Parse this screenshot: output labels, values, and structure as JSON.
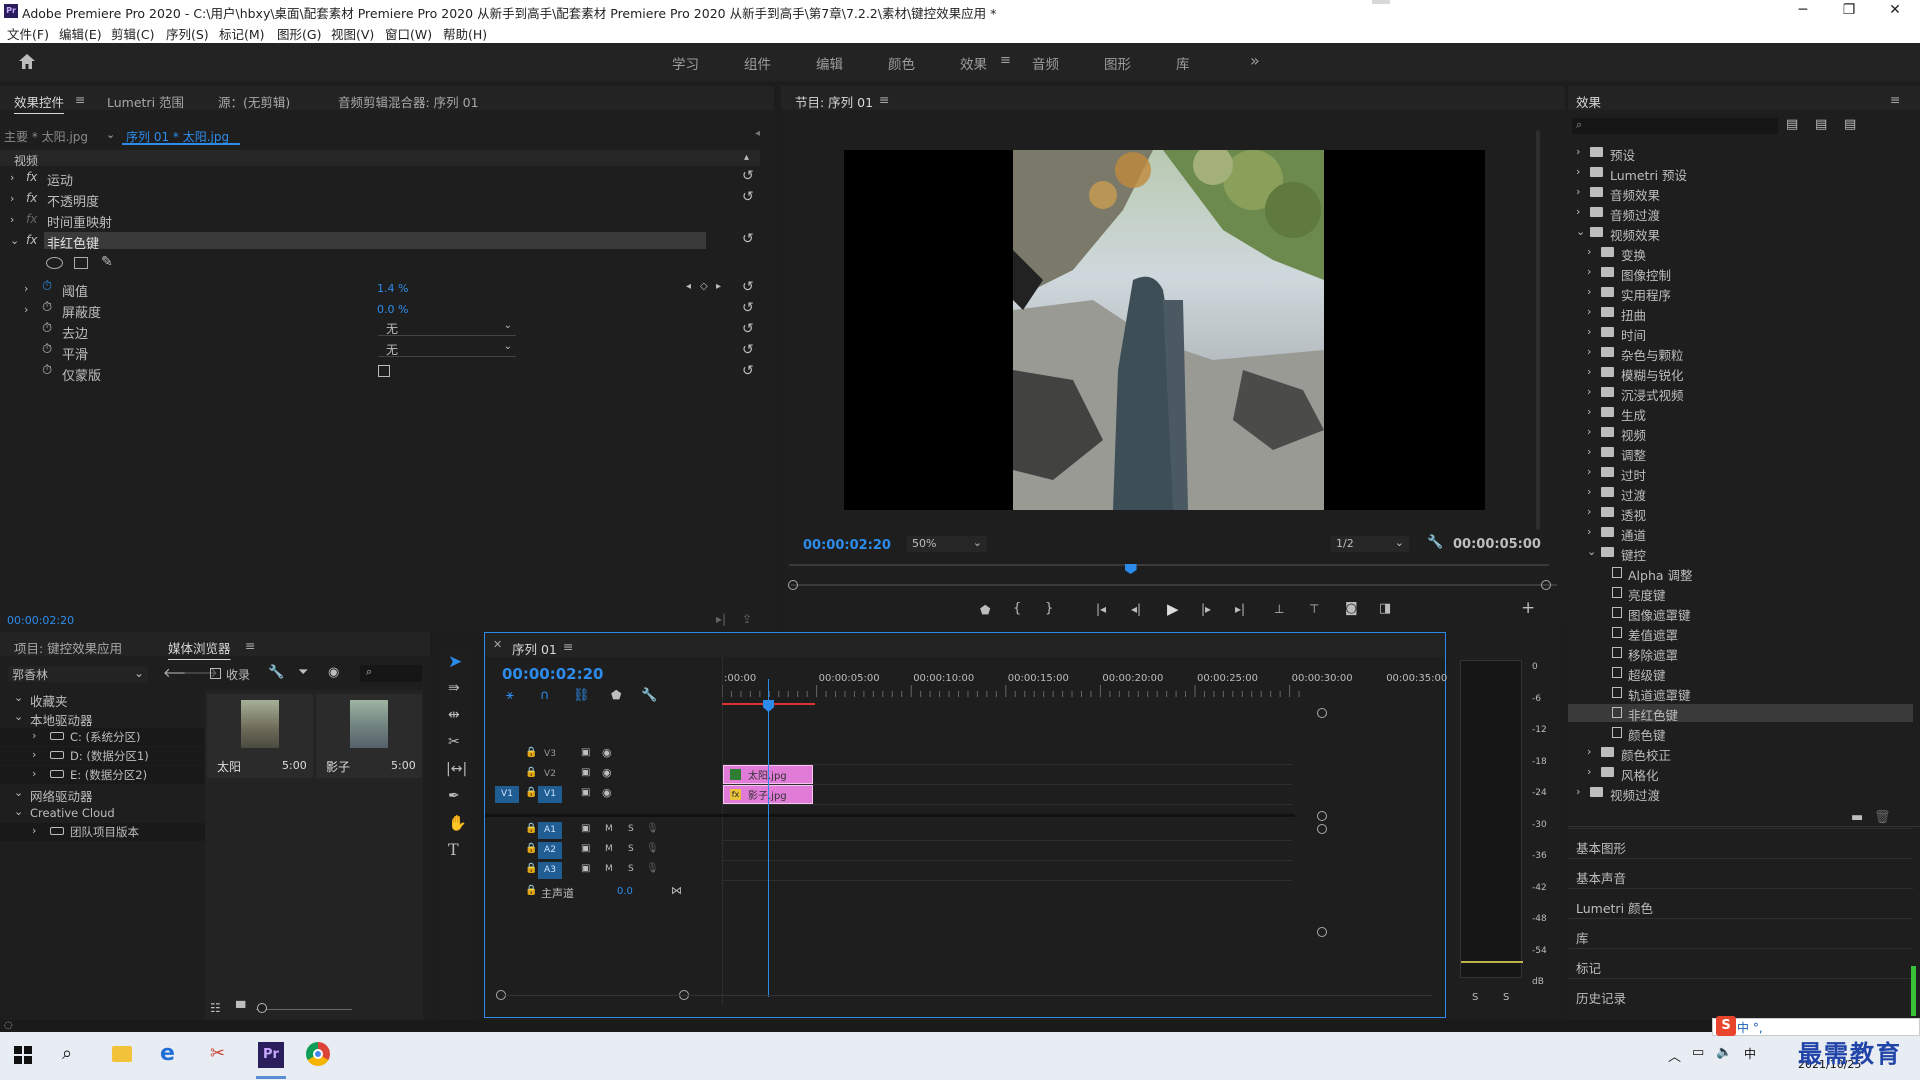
{
  "app": {
    "logo": "Pr",
    "title": "Adobe Premiere Pro 2020 - C:\\用户\\hbxy\\桌面\\配套素材 Premiere Pro 2020 从新手到高手\\配套素材 Premiere Pro 2020 从新手到高手\\第7章\\7.2.2\\素材\\键控效果应用 *"
  },
  "window_controls": {
    "minimize": "─",
    "maximize": "❐",
    "close": "✕"
  },
  "menu": [
    "文件(F)",
    "编辑(E)",
    "剪辑(C)",
    "序列(S)",
    "标记(M)",
    "图形(G)",
    "视图(V)",
    "窗口(W)",
    "帮助(H)"
  ],
  "workspaces": [
    "学习",
    "组件",
    "编辑",
    "颜色",
    "效果",
    "音频",
    "图形",
    "库"
  ],
  "workspace_active": "效果",
  "workspace_more": "»",
  "effect_controls": {
    "tabs": [
      "效果控件",
      "Lumetri 范围",
      "源：(无剪辑)",
      "音频剪辑混合器: 序列 01"
    ],
    "master": "主要 * 太阳.jpg",
    "clip": "序列 01 * 太阳.jpg",
    "section": "视频",
    "effects": [
      "运动",
      "不透明度",
      "时间重映射",
      "非红色键"
    ],
    "params": [
      {
        "name": "阈值",
        "value": "1.4 %"
      },
      {
        "name": "屏蔽度",
        "value": "0.0 %"
      },
      {
        "name": "去边",
        "value": "无"
      },
      {
        "name": "平滑",
        "value": "无"
      },
      {
        "name": "仅蒙版",
        "value": ""
      }
    ],
    "timecode": "00:00:02:20"
  },
  "program": {
    "title": "节目: 序列 01",
    "timecode": "00:00:02:20",
    "zoom": "50%",
    "quality": "1/2",
    "duration": "00:00:05:00",
    "playhead_fraction": 0.56
  },
  "effects_panel": {
    "title": "效果",
    "tree": [
      {
        "label": "预设",
        "level": 0,
        "type": "folder",
        "open": false
      },
      {
        "label": "Lumetri 预设",
        "level": 0,
        "type": "folder",
        "open": false
      },
      {
        "label": "音频效果",
        "level": 0,
        "type": "folder",
        "open": false
      },
      {
        "label": "音频过渡",
        "level": 0,
        "type": "folder",
        "open": false
      },
      {
        "label": "视频效果",
        "level": 0,
        "type": "folder",
        "open": true
      },
      {
        "label": "变换",
        "level": 1,
        "type": "folder",
        "open": false
      },
      {
        "label": "图像控制",
        "level": 1,
        "type": "folder",
        "open": false
      },
      {
        "label": "实用程序",
        "level": 1,
        "type": "folder",
        "open": false
      },
      {
        "label": "扭曲",
        "level": 1,
        "type": "folder",
        "open": false
      },
      {
        "label": "时间",
        "level": 1,
        "type": "folder",
        "open": false
      },
      {
        "label": "杂色与颗粒",
        "level": 1,
        "type": "folder",
        "open": false
      },
      {
        "label": "模糊与锐化",
        "level": 1,
        "type": "folder",
        "open": false
      },
      {
        "label": "沉浸式视频",
        "level": 1,
        "type": "folder",
        "open": false
      },
      {
        "label": "生成",
        "level": 1,
        "type": "folder",
        "open": false
      },
      {
        "label": "视频",
        "level": 1,
        "type": "folder",
        "open": false
      },
      {
        "label": "调整",
        "level": 1,
        "type": "folder",
        "open": false
      },
      {
        "label": "过时",
        "level": 1,
        "type": "folder",
        "open": false
      },
      {
        "label": "过渡",
        "level": 1,
        "type": "folder",
        "open": false
      },
      {
        "label": "透视",
        "level": 1,
        "type": "folder",
        "open": false
      },
      {
        "label": "通道",
        "level": 1,
        "type": "folder",
        "open": false
      },
      {
        "label": "键控",
        "level": 1,
        "type": "folder",
        "open": true
      },
      {
        "label": "Alpha 调整",
        "level": 2,
        "type": "effect"
      },
      {
        "label": "亮度键",
        "level": 2,
        "type": "effect"
      },
      {
        "label": "图像遮罩键",
        "level": 2,
        "type": "effect"
      },
      {
        "label": "差值遮罩",
        "level": 2,
        "type": "effect"
      },
      {
        "label": "移除遮罩",
        "level": 2,
        "type": "effect"
      },
      {
        "label": "超级键",
        "level": 2,
        "type": "effect"
      },
      {
        "label": "轨道遮罩键",
        "level": 2,
        "type": "effect"
      },
      {
        "label": "非红色键",
        "level": 2,
        "type": "effect",
        "selected": true
      },
      {
        "label": "颜色键",
        "level": 2,
        "type": "effect"
      },
      {
        "label": "颜色校正",
        "level": 1,
        "type": "folder",
        "open": false
      },
      {
        "label": "风格化",
        "level": 1,
        "type": "folder",
        "open": false
      },
      {
        "label": "视频过渡",
        "level": 0,
        "type": "folder",
        "open": false
      }
    ],
    "collapsed_panels": [
      "基本图形",
      "基本声音",
      "Lumetri 颜色",
      "库",
      "标记",
      "历史记录"
    ]
  },
  "project": {
    "tabs": [
      "项目: 键控效果应用",
      "媒体浏览器"
    ],
    "location": "郛香林",
    "ingest": "收录",
    "tree": [
      {
        "label": "收藏夹",
        "level": 0
      },
      {
        "label": "本地驱动器",
        "level": 0
      },
      {
        "label": "C: (系统分区)",
        "level": 1
      },
      {
        "label": "D: (数据分区1)",
        "level": 1
      },
      {
        "label": "E: (数据分区2)",
        "level": 1
      },
      {
        "label": "网络驱动器",
        "level": 0
      },
      {
        "label": "Creative Cloud",
        "level": 0
      },
      {
        "label": "团队项目版本",
        "level": 1
      }
    ],
    "thumbs": [
      {
        "name": "太阳",
        "dur": "5:00"
      },
      {
        "name": "影子",
        "dur": "5:00"
      }
    ]
  },
  "timeline": {
    "title": "序列 01",
    "timecode": "00:00:02:20",
    "ruler": [
      ":00:00",
      "00:00:05:00",
      "00:00:10:00",
      "00:00:15:00",
      "00:00:20:00",
      "00:00:25:00",
      "00:00:30:00",
      "00:00:35:00"
    ],
    "video_tracks": [
      "V3",
      "V2",
      "V1"
    ],
    "source_patch": "V1",
    "audio_tracks": [
      "A1",
      "A2",
      "A3"
    ],
    "master": "主声道",
    "master_val": "0.0",
    "mute": "M",
    "solo": "S",
    "clips": [
      {
        "track": "V2",
        "name": "太阳.jpg"
      },
      {
        "track": "V1",
        "name": "影子.jpg"
      }
    ]
  },
  "meter": {
    "scale": [
      "0",
      "-6",
      "-12",
      "-18",
      "-24",
      "-30",
      "-36",
      "-42",
      "-48",
      "-54",
      "dB"
    ],
    "solo": [
      "S",
      "S"
    ]
  },
  "taskbar": {
    "date": "2021/10/25",
    "tray": "中 °,",
    "watermark": "最需教育"
  },
  "colors": {
    "accent": "#2d8ceb",
    "clip": "#e17bd8",
    "selected_row": "#3a3a3a"
  }
}
